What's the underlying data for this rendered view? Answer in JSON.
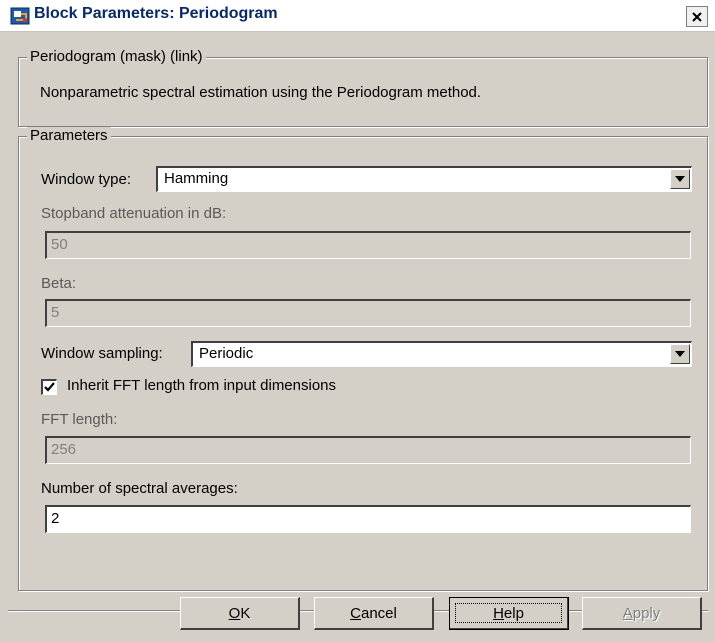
{
  "window": {
    "title": "Block Parameters: Periodogram",
    "icon": "simulink-block-icon",
    "close_icon": "close-icon"
  },
  "description": {
    "group_title": "Periodogram (mask) (link)",
    "text": "Nonparametric spectral estimation using the Periodogram method."
  },
  "parameters": {
    "group_title": "Parameters",
    "window_type": {
      "label": "Window type:",
      "value": "Hamming"
    },
    "stopband": {
      "label": "Stopband attenuation in dB:",
      "value": "50",
      "enabled": false
    },
    "beta": {
      "label": "Beta:",
      "value": "5",
      "enabled": false
    },
    "window_sampling": {
      "label": "Window sampling:",
      "value": "Periodic"
    },
    "inherit_fft": {
      "label": "Inherit FFT length from input dimensions",
      "checked": true
    },
    "fft_length": {
      "label": "FFT length:",
      "value": "256",
      "enabled": false
    },
    "spectral_averages": {
      "label": "Number of spectral averages:",
      "value": "2",
      "enabled": true
    }
  },
  "buttons": {
    "ok": "OK",
    "cancel": "Cancel",
    "help": "Help",
    "apply": "Apply"
  }
}
